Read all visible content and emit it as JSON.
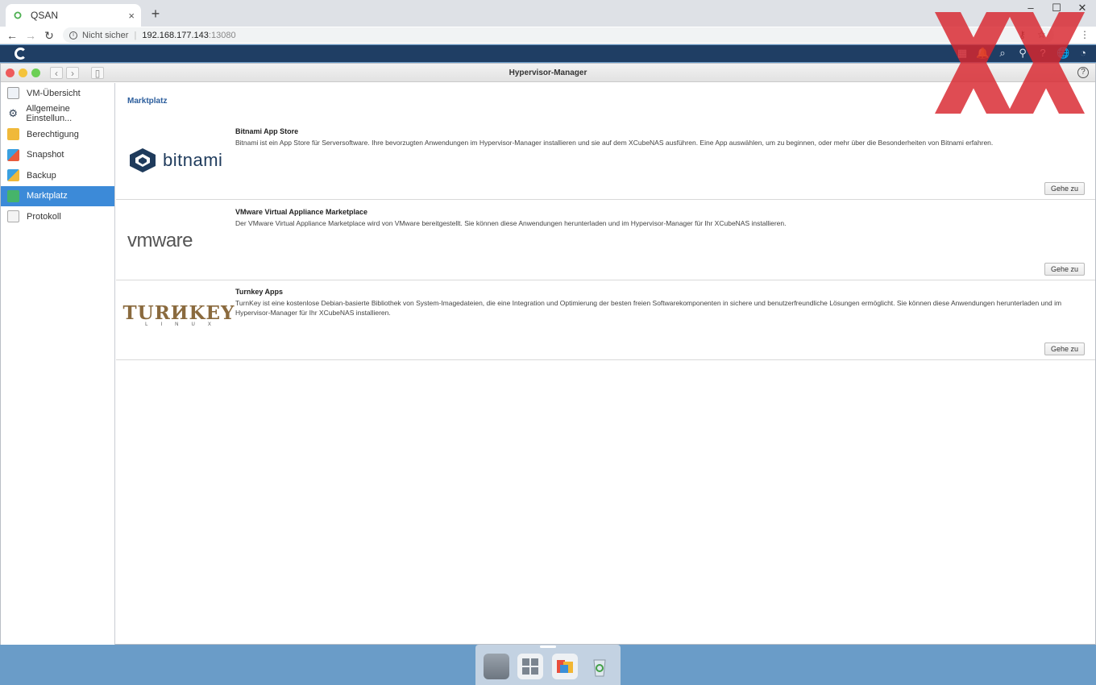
{
  "browser": {
    "tab_title": "QSAN",
    "tab_close": "×",
    "new_tab": "+",
    "security_label": "Nicht sicher",
    "url_host": "192.168.177.143",
    "url_port": ":13080",
    "window_controls": [
      "–",
      "☐",
      "✕"
    ]
  },
  "window": {
    "title": "Hypervisor-Manager",
    "help": "?"
  },
  "sidebar": {
    "items": [
      {
        "label": "VM-Übersicht",
        "icon": "vm-overview-icon",
        "active": false
      },
      {
        "label": "Allgemeine Einstellun...",
        "icon": "settings-gear-icon",
        "active": false
      },
      {
        "label": "Berechtigung",
        "icon": "lock-folder-icon",
        "active": false
      },
      {
        "label": "Snapshot",
        "icon": "snapshot-icon",
        "active": false
      },
      {
        "label": "Backup",
        "icon": "backup-icon",
        "active": false
      },
      {
        "label": "Marktplatz",
        "icon": "marketplace-icon",
        "active": true
      },
      {
        "label": "Protokoll",
        "icon": "log-icon",
        "active": false
      }
    ]
  },
  "main": {
    "section_title": "Marktplatz",
    "apps": [
      {
        "logo": "bitnami",
        "logo_text": "bitnami",
        "name": "Bitnami App Store",
        "description": "Bitnami ist ein App Store für Serversoftware. Ihre bevorzugten Anwendungen im Hypervisor-Manager installieren und sie auf dem XCubeNAS ausführen. Eine App auswählen, um zu beginnen, oder mehr über die Besonderheiten von Bitnami erfahren.",
        "button": "Gehe zu"
      },
      {
        "logo": "vmware",
        "logo_text": "vmware",
        "name": "VMware Virtual Appliance Marketplace",
        "description": "Der VMware Virtual Appliance Marketplace wird von VMware bereitgestellt. Sie können diese Anwendungen herunterladen und im Hypervisor-Manager für Ihr XCubeNAS installieren.",
        "button": "Gehe zu"
      },
      {
        "logo": "turnkey",
        "logo_text": "TURИKEY",
        "logo_sub": "LINUX",
        "name": "Turnkey Apps",
        "description": "TurnKey ist eine kostenlose Debian-basierte Bibliothek von System-Imagedateien, die eine Integration und Optimierung der besten freien Softwarekomponenten in sichere und benutzerfreundliche Lösungen ermöglicht. Sie können diese Anwendungen herunterladen und im Hypervisor-Manager für Ihr XCubeNAS installieren.",
        "button": "Gehe zu"
      }
    ]
  },
  "colors": {
    "accent": "#3c8ad8",
    "qsan_bar": "#1f3e64",
    "section_title": "#2b5d9c",
    "watermark": "#d9262e"
  }
}
